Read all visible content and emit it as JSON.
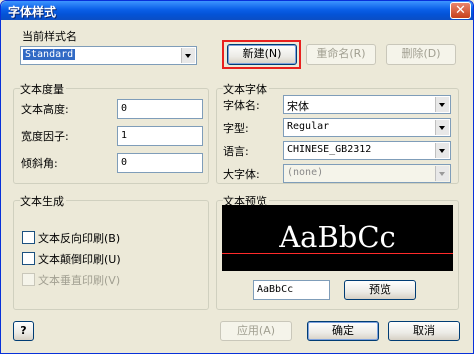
{
  "window": {
    "title": "字体样式",
    "close_glyph": "✕"
  },
  "style_name": {
    "group_label": "当前样式名",
    "current_value": "Standard",
    "new_button": "新建(N)",
    "rename_button": "重命名(R)",
    "delete_button": "删除(D)"
  },
  "text_metrics": {
    "group_label": "文本度量",
    "height_label": "文本高度:",
    "height_value": "0",
    "width_factor_label": "宽度因子:",
    "width_factor_value": "1",
    "oblique_label": "倾斜角:",
    "oblique_value": "0"
  },
  "text_font": {
    "group_label": "文本字体",
    "font_name_label": "字体名:",
    "font_name_value": "宋体",
    "font_style_label": "字型:",
    "font_style_value": "Regular",
    "language_label": "语言:",
    "language_value": "CHINESE_GB2312",
    "bigfont_label": "大字体:",
    "bigfont_value": "(none)"
  },
  "text_generation": {
    "group_label": "文本生成",
    "backwards_label": "文本反向印刷(B)",
    "backwards_checked": false,
    "upside_down_label": "文本颠倒印刷(U)",
    "upside_down_checked": false,
    "vertical_label": "文本垂直印刷(V)",
    "vertical_checked": false
  },
  "text_preview": {
    "group_label": "文本预览",
    "sample_text": "AaBbCc",
    "input_value": "AaBbCc",
    "preview_button": "预览"
  },
  "footer": {
    "help_glyph": "?",
    "apply_button": "应用(A)",
    "ok_button": "确定",
    "cancel_button": "取消"
  },
  "colors": {
    "titlebar": "#0a5fe8",
    "highlight_border": "#e8201e",
    "preview_background": "#000000",
    "preview_baseline": "#ff2a2a"
  }
}
